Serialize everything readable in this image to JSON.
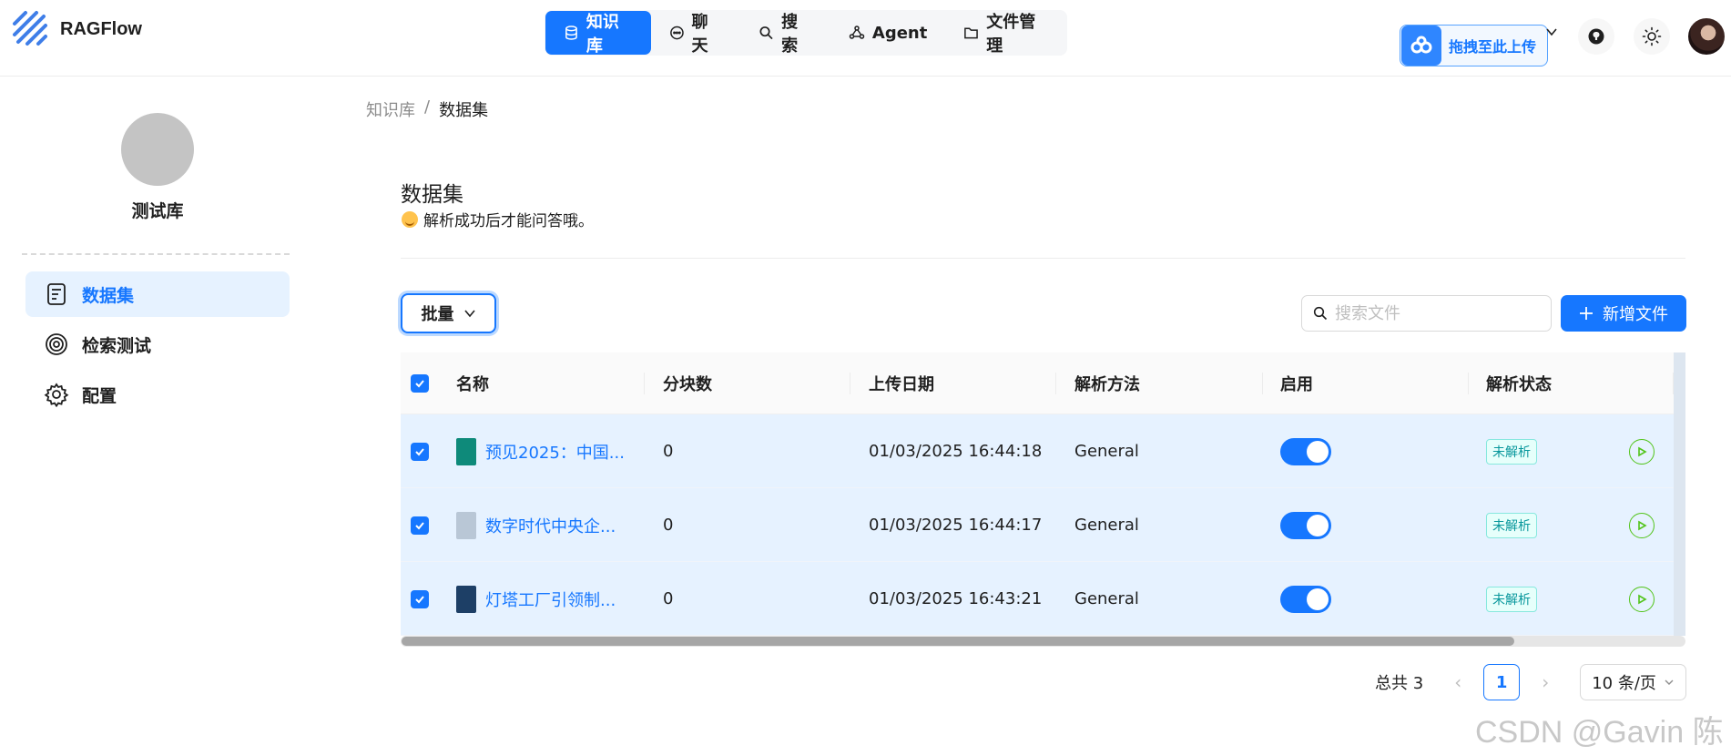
{
  "app": {
    "name": "RAGFlow"
  },
  "nav": {
    "items": [
      {
        "label": "知识库",
        "icon": "database-icon",
        "active": true
      },
      {
        "label": "聊天",
        "icon": "chat-icon",
        "active": false
      },
      {
        "label": "搜索",
        "icon": "search-icon",
        "active": false
      },
      {
        "label": "Agent",
        "icon": "graph-icon",
        "active": false
      },
      {
        "label": "文件管理",
        "icon": "folder-icon",
        "active": false
      }
    ]
  },
  "header": {
    "upload_badge": "拖拽至此上传"
  },
  "sidebar": {
    "kb_name": "测试库",
    "items": [
      {
        "label": "数据集",
        "icon": "document-icon",
        "active": true
      },
      {
        "label": "检索测试",
        "icon": "target-icon",
        "active": false
      },
      {
        "label": "配置",
        "icon": "gear-icon",
        "active": false
      }
    ]
  },
  "breadcrumb": {
    "parent": "知识库",
    "separator": "/",
    "current": "数据集"
  },
  "page": {
    "title": "数据集",
    "description": "解析成功后才能问答哦。"
  },
  "toolbar": {
    "batch_label": "批量",
    "search_placeholder": "搜索文件",
    "add_label": "新增文件"
  },
  "table": {
    "columns": [
      "名称",
      "分块数",
      "上传日期",
      "解析方法",
      "启用",
      "解析状态"
    ],
    "rows": [
      {
        "name": "预见2025：中国...",
        "chunks": "0",
        "date": "01/03/2025 16:44:18",
        "method": "General",
        "status": "未解析",
        "thumb": "#0e8a7a"
      },
      {
        "name": "数字时代中央企...",
        "chunks": "0",
        "date": "01/03/2025 16:44:17",
        "method": "General",
        "status": "未解析",
        "thumb": "#b9c7d6"
      },
      {
        "name": "灯塔工厂引领制...",
        "chunks": "0",
        "date": "01/03/2025 16:43:21",
        "method": "General",
        "status": "未解析",
        "thumb": "#1d3f66"
      }
    ]
  },
  "pagination": {
    "total": "总共 3",
    "current": "1",
    "page_size": "10 条/页"
  },
  "watermark": "CSDN @Gavin 陈",
  "colors": {
    "accent": "#1677ff",
    "status_tag": "#08979c",
    "row_selected": "#e6f2ff"
  }
}
